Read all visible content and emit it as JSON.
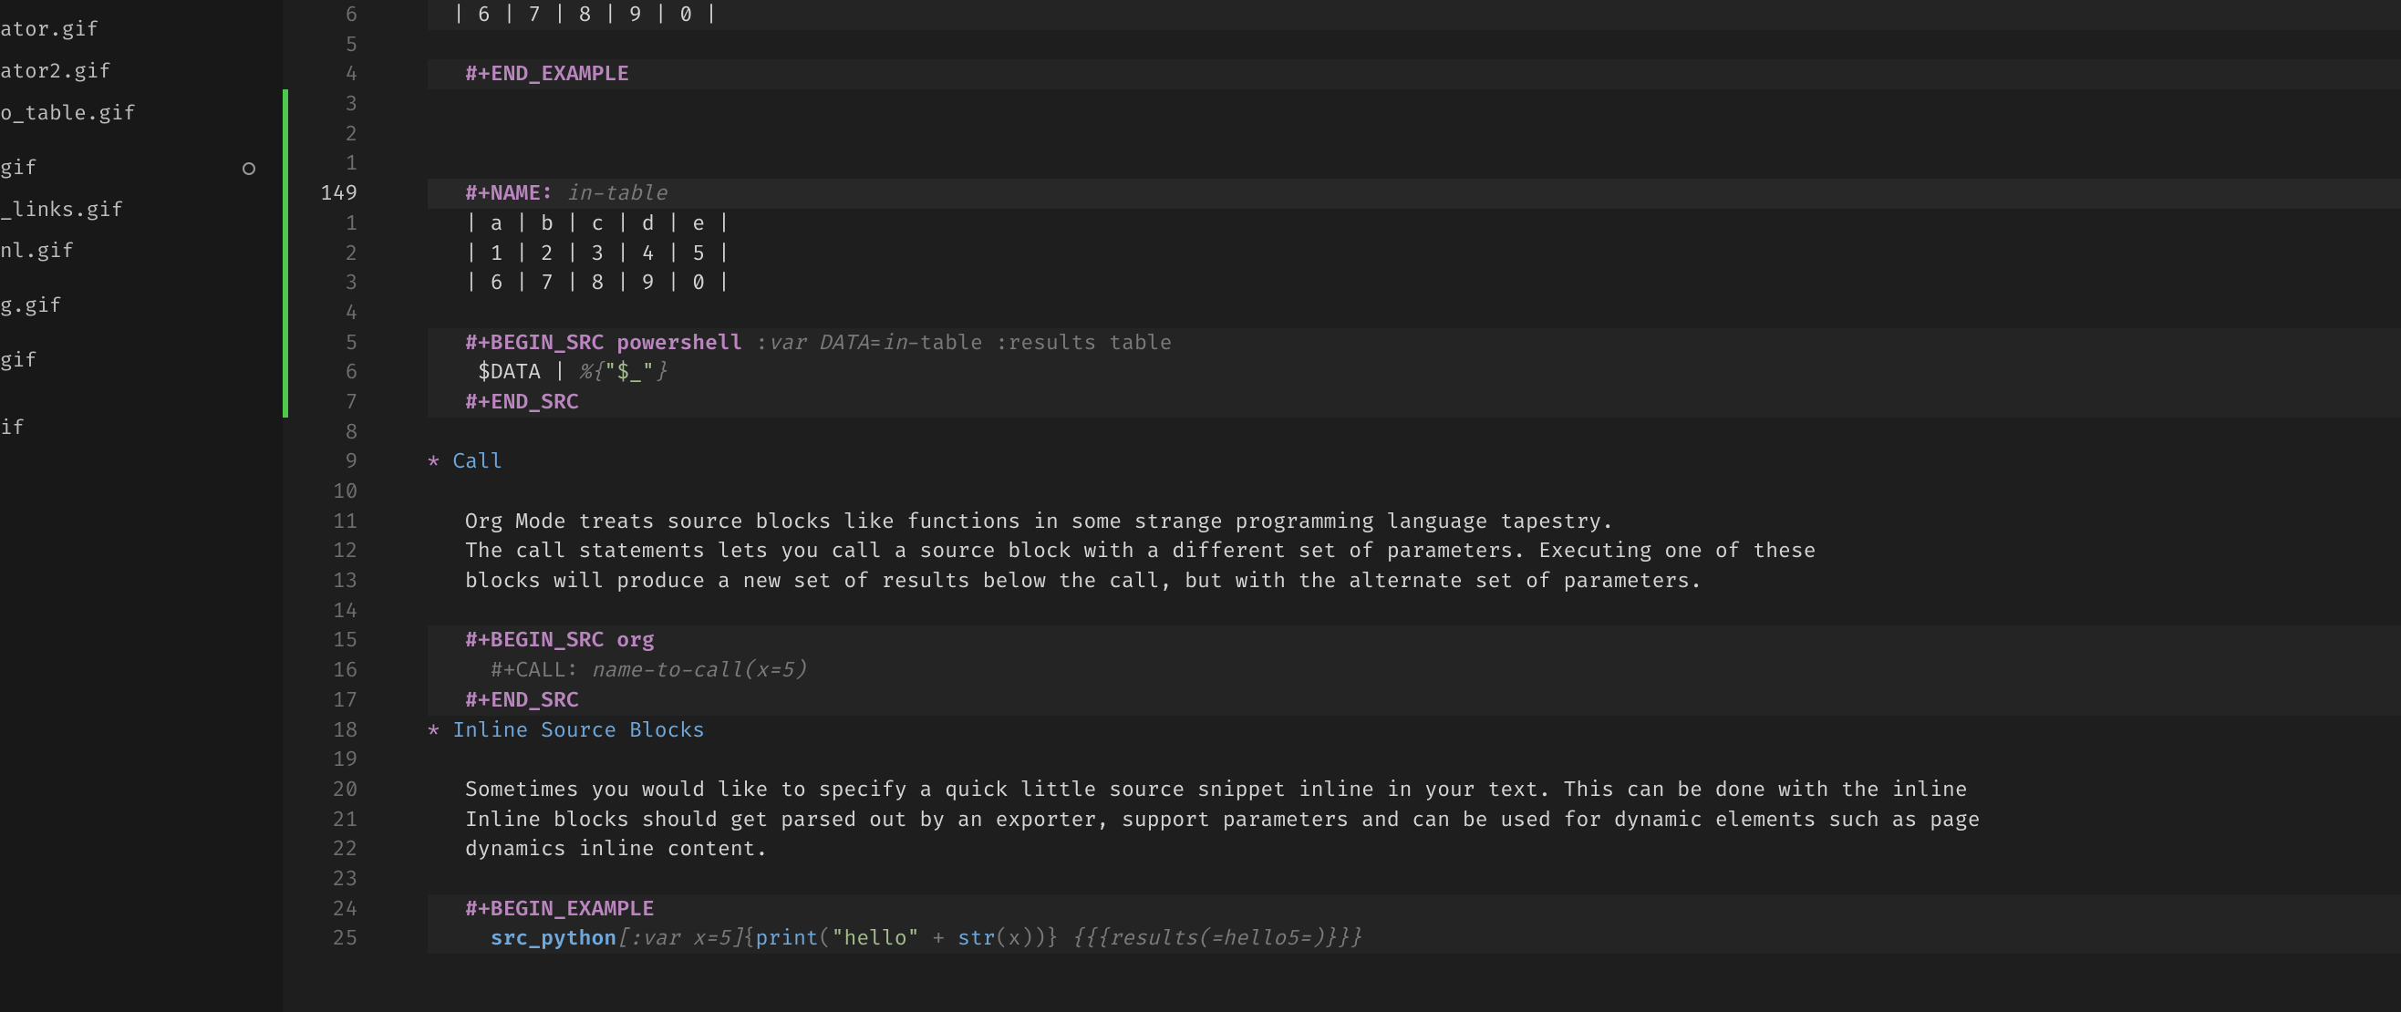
{
  "sidebar": {
    "files": [
      {
        "label": "ator.gif",
        "dirty": false
      },
      {
        "label": "ator2.gif",
        "dirty": false
      },
      {
        "label": "o_table.gif",
        "dirty": false
      },
      {
        "label": "",
        "dirty": false
      },
      {
        "label": "gif",
        "dirty": true
      },
      {
        "label": "_links.gif",
        "dirty": false
      },
      {
        "label": "nl.gif",
        "dirty": false
      },
      {
        "label": "",
        "dirty": false
      },
      {
        "label": "g.gif",
        "dirty": false
      },
      {
        "label": "",
        "dirty": false
      },
      {
        "label": "gif",
        "dirty": false
      },
      {
        "label": "",
        "dirty": false
      },
      {
        "label": "",
        "dirty": false
      },
      {
        "label": "if",
        "dirty": false
      }
    ]
  },
  "gutter": [
    "6",
    "5",
    "4",
    "3",
    "2",
    "1",
    "149",
    "1",
    "2",
    "3",
    "4",
    "5",
    "6",
    "7",
    "8",
    "9",
    "10",
    "11",
    "12",
    "13",
    "14",
    "15",
    "16",
    "17",
    "18",
    "19",
    "20",
    "21",
    "22",
    "23",
    "24",
    "25"
  ],
  "currentLineLabel": "149",
  "diffSegments": [
    {
      "from": 3,
      "to": 13
    }
  ],
  "code": {
    "table_top_row": "| 6 | 7 | 8 | 9 | 0 |",
    "end_example": "#+END_EXAMPLE",
    "name_kw": "#+NAME:",
    "name_val": "in-table",
    "in_table_r1": "| a | b | c | d | e |",
    "in_table_r2": "| 1 | 2 | 3 | 4 | 5 |",
    "in_table_r3": "| 6 | 7 | 8 | 9 | 0 |",
    "begin_src_ps": "#+BEGIN_SRC",
    "ps_lang": "powershell",
    "ps_args_pre": " :",
    "ps_args_var": "var DATA",
    "ps_args_eq": "=",
    "ps_args_in": "in",
    "ps_args_rest": "-table :results table",
    "ps_body1": " $DATA | ",
    "ps_body1_op": "%{",
    "ps_body1_str": "\"$_\"",
    "ps_body1_close": "}",
    "end_src": "#+END_SRC",
    "hdr_call": "Call",
    "call_p1": "Org Mode treats source blocks like functions in some strange programming language tapestry.",
    "call_p2": "The call statements lets you call a source block with a different set of parameters. Executing one of these",
    "call_p3": "blocks will produce a new set of results below the call, but with the alternate set of parameters.",
    "begin_src_org": "#+BEGIN_SRC",
    "org_lang": "org",
    "call_kw": "#+CALL:",
    "call_val": "name-to-call(x=5)",
    "hdr_inline": "Inline Source Blocks",
    "inline_p1": "Sometimes you would like to specify a quick little source snippet inline in your text. This can be done with the inline",
    "inline_p2": "Inline blocks should get parsed out by an exporter, support parameters and can be used for dynamic elements such as page",
    "inline_p3": "dynamics inline content.",
    "begin_example": "#+BEGIN_EXAMPLE",
    "src_python_kw": "src_python",
    "src_python_args": "[:var x=5]",
    "src_python_body_open": "{",
    "src_python_body_fn": "print",
    "src_python_body_paren_o": "(",
    "src_python_body_str": "\"hello\"",
    "src_python_body_plus": " + ",
    "src_python_body_strfn": "str",
    "src_python_body_px": "(x))}",
    "src_python_results": " {{{results(",
    "src_python_results_val": "=hello5=",
    "src_python_results_close": ")}}}"
  }
}
